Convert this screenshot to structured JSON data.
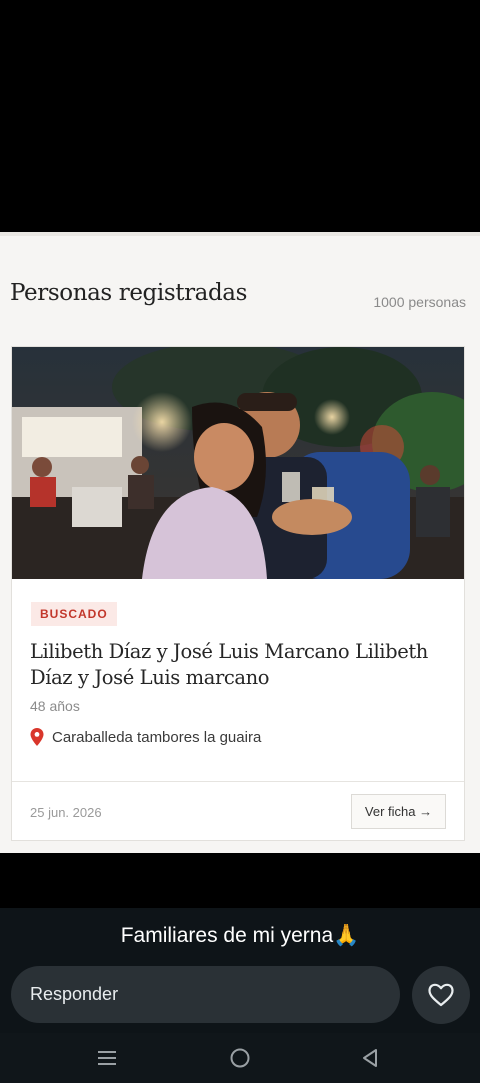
{
  "listing": {
    "title": "Personas registradas",
    "count": "1000 personas",
    "card": {
      "badge": "BUSCADO",
      "name": "Lilibeth Díaz y José Luis Marcano Lilibeth Díaz y José Luis marcano",
      "age": "48 años",
      "location": "Caraballeda tambores la guaira",
      "date": "25 jun. 2026",
      "view_label": "Ver ficha →"
    }
  },
  "story": {
    "caption": "Familiares de mi yerna🙏",
    "reply_placeholder": "Responder"
  },
  "icons": {
    "location": "location-pin-icon",
    "like": "heart-icon",
    "nav": [
      "menu-icon",
      "home-icon",
      "back-icon"
    ]
  },
  "colors": {
    "badge_text": "#c2372b",
    "badge_bg": "#fbe9e6",
    "pin": "#d9362b",
    "panel_bg": "#f6f5f3"
  }
}
